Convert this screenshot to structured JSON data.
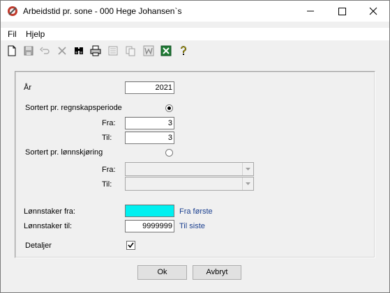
{
  "window": {
    "title": "Arbeidstid pr. sone - 000 Hege Johansen`s"
  },
  "menu": {
    "items": [
      {
        "label": "Fil"
      },
      {
        "label": "Hjelp"
      }
    ]
  },
  "toolbar": {
    "icons": [
      "new-icon",
      "save-icon",
      "undo-icon",
      "delete-icon",
      "find-icon",
      "print-icon",
      "preview-icon",
      "copy-icon",
      "word-icon",
      "excel-icon",
      "help-icon"
    ]
  },
  "form": {
    "year_label": "År",
    "year_value": "2021",
    "sort_period_label": "Sortert pr. regnskapsperiode",
    "period_from_label": "Fra:",
    "period_from_value": "3",
    "period_to_label": "Til:",
    "period_to_value": "3",
    "sort_payroll_label": "Sortert pr. lønnskjøring",
    "payroll_from_label": "Fra:",
    "payroll_to_label": "Til:",
    "employee_from_label": "Lønnstaker fra:",
    "employee_from_value": "",
    "employee_from_hint": "Fra første",
    "employee_to_label": "Lønnstaker til:",
    "employee_to_value": "9999999",
    "employee_to_hint": "Til siste",
    "details_label": "Detaljer"
  },
  "buttons": {
    "ok_label": "Ok",
    "cancel_label": "Avbryt"
  },
  "colors": {
    "employee_from_bg": "#00f0f0",
    "hint_text": "#1a3f8f"
  }
}
